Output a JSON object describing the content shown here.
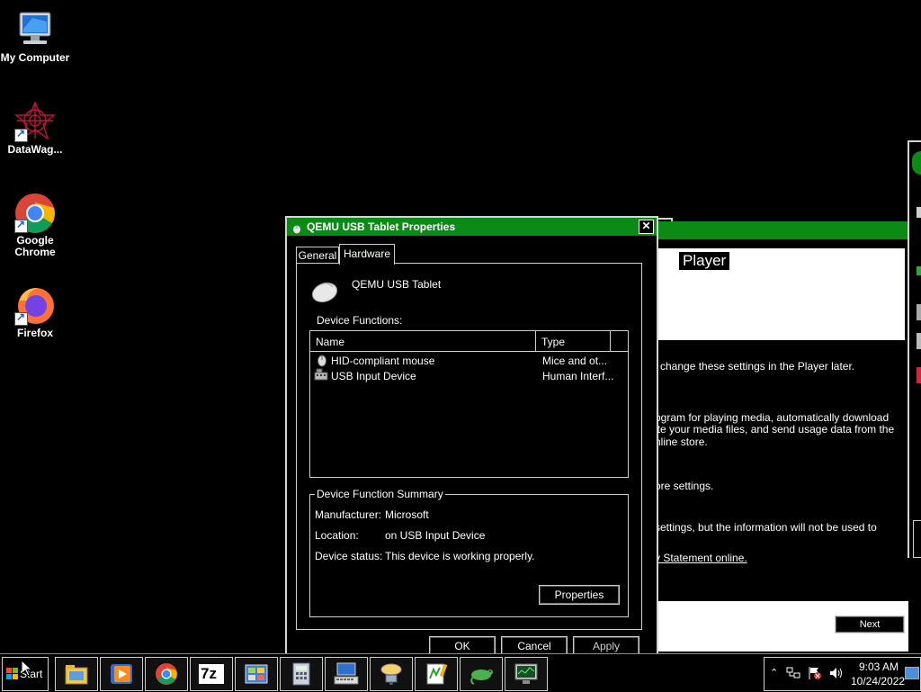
{
  "desktop": {
    "icons": [
      {
        "label": "My Computer",
        "icon": "computer-icon"
      },
      {
        "label": "DataWag...",
        "icon": "datawagon-icon"
      },
      {
        "label": "Google Chrome",
        "icon": "chrome-icon"
      },
      {
        "label": "Firefox",
        "icon": "firefox-icon"
      }
    ]
  },
  "background_window": {
    "heading": "Player",
    "lines": [
      "change these settings in the Player later.",
      "ogram for playing media, automatically download",
      "ite your media files, and send usage data from the",
      "nline store.",
      "ore settings.",
      "settings, but the information will not be used to",
      "y Statement online."
    ],
    "next_button": "Next"
  },
  "dialog": {
    "title": "QEMU USB Tablet Properties",
    "tabs": [
      "General",
      "Hardware"
    ],
    "active_tab": "Hardware",
    "device_name": "QEMU USB Tablet",
    "device_functions_label": "Device Functions:",
    "columns": [
      "Name",
      "Type"
    ],
    "rows": [
      {
        "name": "HID-compliant mouse",
        "type": "Mice and ot...",
        "icon": "mouse-icon"
      },
      {
        "name": "USB Input Device",
        "type": "Human Interf...",
        "icon": "usb-device-icon"
      }
    ],
    "summary": {
      "legend": "Device Function Summary",
      "manufacturer_label": "Manufacturer:",
      "manufacturer": "Microsoft",
      "location_label": "Location:",
      "location": "on USB Input Device",
      "status_label": "Device status:",
      "status": "This device is working properly.",
      "properties_button": "Properties"
    },
    "buttons": {
      "ok": "OK",
      "cancel": "Cancel",
      "apply": "Apply"
    },
    "close": "✕"
  },
  "taskbar": {
    "start_label": "Start",
    "apps": [
      "explorer-icon",
      "media-player-icon",
      "chrome-icon",
      "7zip-icon",
      "control-panel-icon",
      "calculator-icon",
      "keyboard-icon",
      "network-icon",
      "notepad-plus-icon",
      "gecko-icon",
      "monitor-icon"
    ],
    "clock_time": "9:03 AM",
    "clock_date": "10/24/2022"
  },
  "colors": {
    "title_green": "#0b8a16",
    "background": "#000000"
  }
}
